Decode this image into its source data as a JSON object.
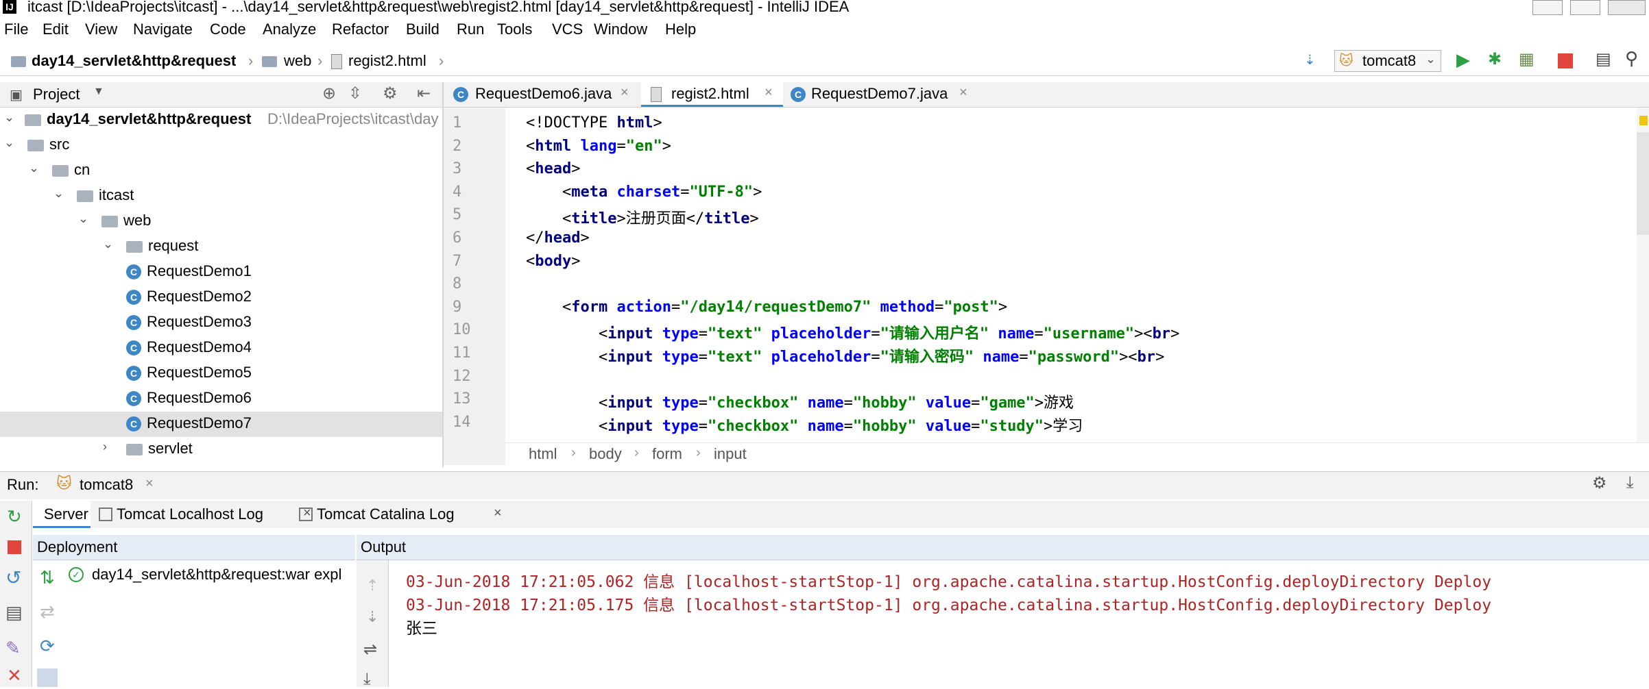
{
  "window": {
    "title": "itcast [D:\\IdeaProjects\\itcast] - ...\\day14_servlet&http&request\\web\\regist2.html [day14_servlet&http&request] - IntelliJ IDEA"
  },
  "menu": [
    "File",
    "Edit",
    "View",
    "Navigate",
    "Code",
    "Analyze",
    "Refactor",
    "Build",
    "Run",
    "Tools",
    "VCS",
    "Window",
    "Help"
  ],
  "nav": {
    "crumbs": [
      "day14_servlet&http&request",
      "web",
      "regist2.html"
    ],
    "run_config": "tomcat8"
  },
  "project": {
    "header": "Project",
    "root_label": "day14_servlet&http&request",
    "root_path": "D:\\IdeaProjects\\itcast\\day",
    "tree": [
      {
        "label": "src",
        "indent": 1
      },
      {
        "label": "cn",
        "indent": 2
      },
      {
        "label": "itcast",
        "indent": 3
      },
      {
        "label": "web",
        "indent": 4
      },
      {
        "label": "request",
        "indent": 5
      },
      {
        "label": "RequestDemo1",
        "indent": 6,
        "cls": true
      },
      {
        "label": "RequestDemo2",
        "indent": 6,
        "cls": true
      },
      {
        "label": "RequestDemo3",
        "indent": 6,
        "cls": true
      },
      {
        "label": "RequestDemo4",
        "indent": 6,
        "cls": true
      },
      {
        "label": "RequestDemo5",
        "indent": 6,
        "cls": true
      },
      {
        "label": "RequestDemo6",
        "indent": 6,
        "cls": true
      },
      {
        "label": "RequestDemo7",
        "indent": 6,
        "cls": true,
        "selected": true
      },
      {
        "label": "servlet",
        "indent": 5,
        "collapsed": true
      }
    ]
  },
  "tabs": [
    {
      "label": "RequestDemo6.java",
      "kind": "class"
    },
    {
      "label": "regist2.html",
      "kind": "html",
      "active": true
    },
    {
      "label": "RequestDemo7.java",
      "kind": "class"
    }
  ],
  "editor": {
    "lines": [
      {
        "n": "1",
        "html": "&lt;!DOCTYPE <span class='kw'>html</span>&gt;"
      },
      {
        "n": "2",
        "html": "&lt;<span class='kw'>html</span> <span class='at'>lang</span>=<span class='st'>\"en\"</span>&gt;"
      },
      {
        "n": "3",
        "html": "&lt;<span class='kw'>head</span>&gt;"
      },
      {
        "n": "4",
        "html": "    &lt;<span class='kw'>meta</span> <span class='at'>charset</span>=<span class='st'>\"UTF-8\"</span>&gt;"
      },
      {
        "n": "5",
        "html": "    &lt;<span class='kw'>title</span>&gt;注册页面&lt;/<span class='kw'>title</span>&gt;"
      },
      {
        "n": "6",
        "html": "&lt;/<span class='kw'>head</span>&gt;"
      },
      {
        "n": "7",
        "html": "&lt;<span class='kw'>body</span>&gt;"
      },
      {
        "n": "8",
        "html": ""
      },
      {
        "n": "9",
        "html": "    &lt;<span class='kw'>form</span> <span class='at'>action</span>=<span class='st'>\"/day14/requestDemo7\"</span> <span class='at'>method</span>=<span class='st'>\"post\"</span>&gt;"
      },
      {
        "n": "10",
        "html": "        &lt;<span class='kw'>input</span> <span class='at'>type</span>=<span class='st'>\"text\"</span> <span class='at'>placeholder</span>=<span class='st'>\"请输入用户名\"</span> <span class='at'>name</span>=<span class='st'>\"username\"</span>&gt;&lt;<span class='kw'>br</span>&gt;"
      },
      {
        "n": "11",
        "html": "        &lt;<span class='kw'>input</span> <span class='at'>type</span>=<span class='st'>\"text\"</span> <span class='at'>placeholder</span>=<span class='st'>\"请输入密码\"</span> <span class='at'>name</span>=<span class='st'>\"password\"</span>&gt;&lt;<span class='kw'>br</span>&gt;"
      },
      {
        "n": "12",
        "html": ""
      },
      {
        "n": "13",
        "html": "        &lt;<span class='kw'>input</span> <span class='at'>type</span>=<span class='st'>\"checkbox\"</span> <span class='at'>name</span>=<span class='st'>\"hobby\"</span> <span class='at'>value</span>=<span class='st'>\"game\"</span>&gt;游戏"
      },
      {
        "n": "14",
        "html": "        &lt;<span class='kw'>input</span> <span class='at'>type</span>=<span class='st'>\"checkbox\"</span> <span class='at'>name</span>=<span class='st'>\"hobby\"</span> <span class='at'>value</span>=<span class='st'>\"study\"</span>&gt;学习"
      }
    ],
    "crumbs": [
      "html",
      "body",
      "form",
      "input"
    ]
  },
  "run": {
    "label": "Run:",
    "config": "tomcat8",
    "tabs": [
      "Server",
      "Tomcat Localhost Log",
      "Tomcat Catalina Log"
    ],
    "deployment_header": "Deployment",
    "output_header": "Output",
    "deployment_item": "day14_servlet&http&request:war expl",
    "log": [
      "03-Jun-2018 17:21:05.062 信息 [localhost-startStop-1] org.apache.catalina.startup.HostConfig.deployDirectory Deploy",
      "03-Jun-2018 17:21:05.175 信息 [localhost-startStop-1] org.apache.catalina.startup.HostConfig.deployDirectory Deploy"
    ],
    "stdout": "张三"
  },
  "colors": {
    "accent_blue": "#3d87c7",
    "log_red": "#b22222",
    "selected_row": "#e2e2e2",
    "run_green": "#2ea043",
    "stop_red": "#e0443b"
  }
}
